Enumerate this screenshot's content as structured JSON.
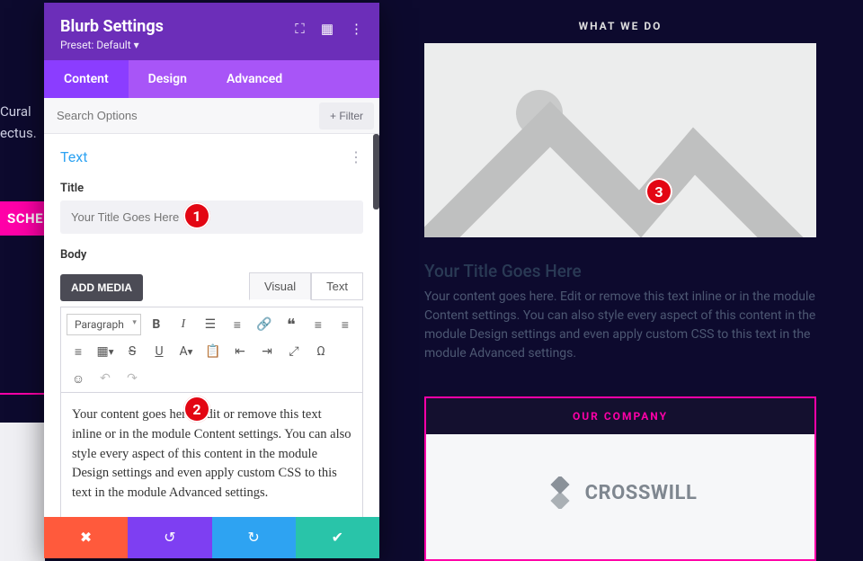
{
  "panel": {
    "title": "Blurb Settings",
    "preset": "Preset: Default ▾",
    "icons": {
      "responsive": "⛶",
      "wireframe": "▦",
      "more": "⋮"
    },
    "tabs": {
      "content": "Content",
      "design": "Design",
      "advanced": "Advanced"
    },
    "search_placeholder": "Search Options",
    "filter_label": "+  Filter",
    "section": {
      "heading": "Text",
      "title_label": "Title",
      "title_placeholder": "Your Title Goes Here",
      "body_label": "Body",
      "add_media": "ADD MEDIA",
      "editor_tabs": {
        "visual": "Visual",
        "text": "Text"
      },
      "paragraph": "Paragraph",
      "body_text": "Your content goes here. Edit or remove this text inline or in the module Content settings. You can also style every aspect of this content in the module Design settings and even apply custom CSS to this text in the module Advanced settings."
    },
    "actions": {
      "cancel": "✖",
      "undo": "↺",
      "redo": "↻",
      "save": "✔"
    }
  },
  "page": {
    "bg_line1": "Cural",
    "bg_line2": "ectus.",
    "sched": "SCHED",
    "whatwedo": "WHAT WE DO",
    "preview_title": "Your Title Goes Here",
    "preview_body": "Your content goes here. Edit or remove this text inline or in the module Content settings. You can also style every aspect of this content in the module Design settings and even apply custom CSS to this text in the module Advanced settings.",
    "company_heading": "OUR COMPANY",
    "company_name": "CROSSWILL"
  },
  "callouts": {
    "c1": "1",
    "c2": "2",
    "c3": "3"
  },
  "toolbar_icons": {
    "bold": "B",
    "italic": "I",
    "ul": "≣",
    "ol": "�ották",
    "ol2": "≡",
    "link": "🔗",
    "quote": "❝",
    "alignl": "≡",
    "alignc": "≡",
    "alignr": "≡",
    "table": "▦",
    "strike": "S",
    "under": "U",
    "color": "A",
    "paste": "📋",
    "outdent": "⇤",
    "indent": "⇥",
    "full": "⤢",
    "omega": "Ω",
    "emoji": "☺",
    "undo": "↶",
    "redo": "↷"
  }
}
